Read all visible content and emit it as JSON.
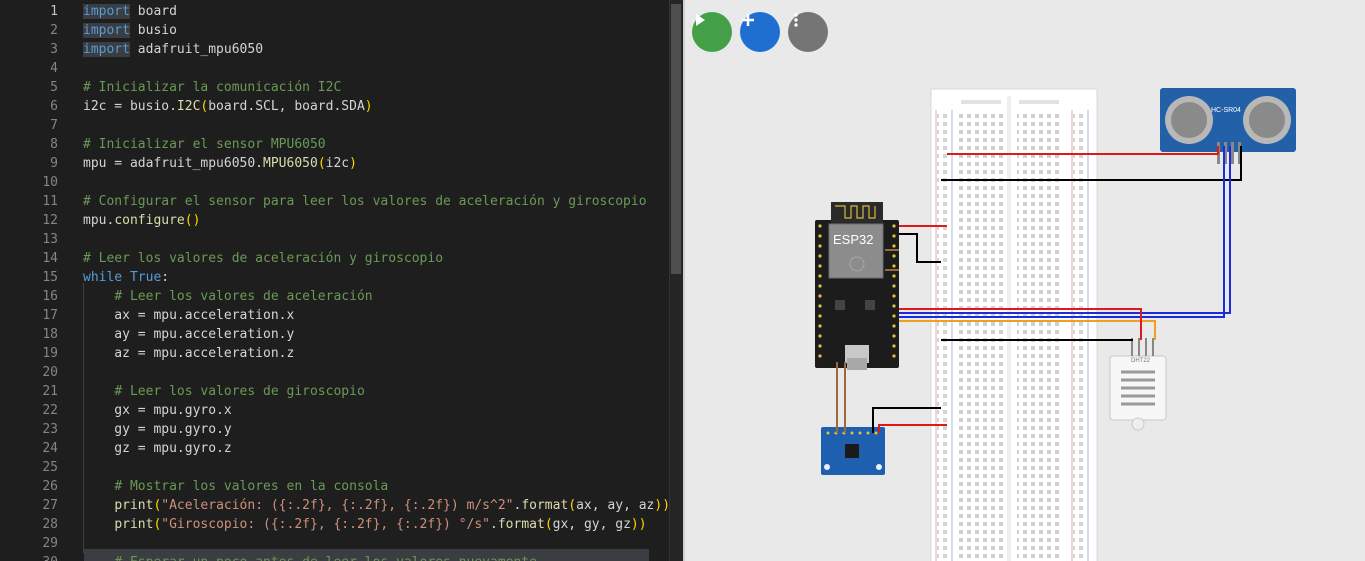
{
  "editor": {
    "lines": [
      {
        "n": "1",
        "t": [
          [
            "kw hl",
            "import"
          ],
          [
            "pl",
            " board"
          ]
        ]
      },
      {
        "n": "2",
        "t": [
          [
            "kw hl",
            "import"
          ],
          [
            "pl",
            " busio"
          ]
        ]
      },
      {
        "n": "3",
        "t": [
          [
            "kw hl",
            "import"
          ],
          [
            "pl",
            " adafruit_mpu6050"
          ]
        ]
      },
      {
        "n": "4",
        "t": []
      },
      {
        "n": "5",
        "t": [
          [
            "cm",
            "# Inicializar la comunicación I2C"
          ]
        ]
      },
      {
        "n": "6",
        "t": [
          [
            "pl",
            "i2c = busio."
          ],
          [
            "fn",
            "I2C"
          ],
          [
            "br",
            "("
          ],
          [
            "pl",
            "board.SCL, board.SDA"
          ],
          [
            "br",
            ")"
          ]
        ]
      },
      {
        "n": "7",
        "t": []
      },
      {
        "n": "8",
        "t": [
          [
            "cm",
            "# Inicializar el sensor MPU6050"
          ]
        ]
      },
      {
        "n": "9",
        "t": [
          [
            "pl",
            "mpu = adafruit_mpu6050."
          ],
          [
            "fn",
            "MPU6050"
          ],
          [
            "br",
            "("
          ],
          [
            "pl",
            "i2c"
          ],
          [
            "br",
            ")"
          ]
        ]
      },
      {
        "n": "10",
        "t": []
      },
      {
        "n": "11",
        "t": [
          [
            "cm",
            "# Configurar el sensor para leer los valores de aceleración y giroscopio"
          ]
        ]
      },
      {
        "n": "12",
        "t": [
          [
            "pl",
            "mpu."
          ],
          [
            "fn",
            "configure"
          ],
          [
            "br",
            "()"
          ]
        ]
      },
      {
        "n": "13",
        "t": []
      },
      {
        "n": "14",
        "t": [
          [
            "cm",
            "# Leer los valores de aceleración y giroscopio"
          ]
        ]
      },
      {
        "n": "15",
        "t": [
          [
            "kw",
            "while"
          ],
          [
            "pl",
            " "
          ],
          [
            "kw",
            "True"
          ],
          [
            "pl",
            ":"
          ]
        ]
      },
      {
        "n": "16",
        "t": [
          [
            "pl",
            "    "
          ],
          [
            "cm",
            "# Leer los valores de aceleración"
          ]
        ]
      },
      {
        "n": "17",
        "t": [
          [
            "pl",
            "    ax = mpu.acceleration.x"
          ]
        ]
      },
      {
        "n": "18",
        "t": [
          [
            "pl",
            "    ay = mpu.acceleration.y"
          ]
        ]
      },
      {
        "n": "19",
        "t": [
          [
            "pl",
            "    az = mpu.acceleration.z"
          ]
        ]
      },
      {
        "n": "20",
        "t": []
      },
      {
        "n": "21",
        "t": [
          [
            "pl",
            "    "
          ],
          [
            "cm",
            "# Leer los valores de giroscopio"
          ]
        ]
      },
      {
        "n": "22",
        "t": [
          [
            "pl",
            "    gx = mpu.gyro.x"
          ]
        ]
      },
      {
        "n": "23",
        "t": [
          [
            "pl",
            "    gy = mpu.gyro.y"
          ]
        ]
      },
      {
        "n": "24",
        "t": [
          [
            "pl",
            "    gz = mpu.gyro.z"
          ]
        ]
      },
      {
        "n": "25",
        "t": []
      },
      {
        "n": "26",
        "t": [
          [
            "pl",
            "    "
          ],
          [
            "cm",
            "# Mostrar los valores en la consola"
          ]
        ]
      },
      {
        "n": "27",
        "t": [
          [
            "pl",
            "    "
          ],
          [
            "fn",
            "print"
          ],
          [
            "br",
            "("
          ],
          [
            "st",
            "\"Aceleración: ({:.2f}, {:.2f}, {:.2f}) m/s^2\""
          ],
          [
            "pl",
            "."
          ],
          [
            "fn",
            "format"
          ],
          [
            "br",
            "("
          ],
          [
            "pl",
            "ax, ay, az"
          ],
          [
            "br",
            "))"
          ]
        ]
      },
      {
        "n": "28",
        "t": [
          [
            "pl",
            "    "
          ],
          [
            "fn",
            "print"
          ],
          [
            "br",
            "("
          ],
          [
            "st",
            "\"Giroscopio: ({:.2f}, {:.2f}, {:.2f}) °/s\""
          ],
          [
            "pl",
            "."
          ],
          [
            "fn",
            "format"
          ],
          [
            "br",
            "("
          ],
          [
            "pl",
            "gx, gy, gz"
          ],
          [
            "br",
            "))"
          ]
        ]
      },
      {
        "n": "29",
        "t": []
      },
      {
        "n": "30",
        "t": [
          [
            "pl",
            "    "
          ],
          [
            "cm",
            "# Esperar un poco antes de leer los valores nuevamente"
          ]
        ]
      }
    ]
  },
  "toolbar": {
    "run_icon": "play-icon",
    "add_icon": "plus-icon",
    "menu_icon": "kebab-menu-icon",
    "run_color": "#43a047",
    "add_color": "#1e6fd0",
    "menu_color": "#757575"
  },
  "circuit": {
    "esp32_label": "ESP32",
    "ultrasonic_label": "HC-SR04",
    "dht_label": "DHT22",
    "wire_colors": {
      "power": "#e01818",
      "ground": "#000000",
      "signal_blue": "#1b2be0",
      "signal_orange": "#f0a020"
    }
  }
}
